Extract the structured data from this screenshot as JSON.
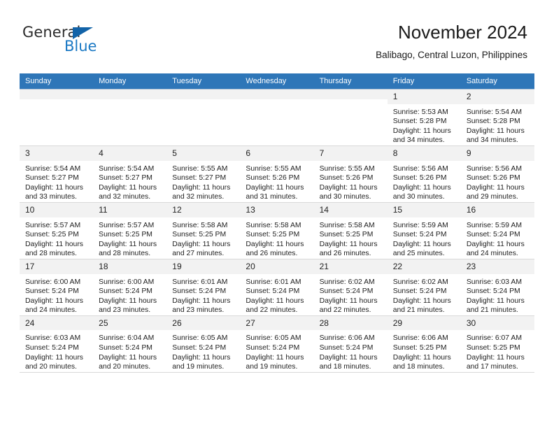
{
  "brand": {
    "name_part1": "General",
    "name_part2": "Blue",
    "accent_color": "#1b79c4",
    "triangle_color": "#1263a8",
    "triangle_icon": "triangle-icon"
  },
  "header": {
    "title": "November 2024",
    "subtitle": "Balibago, Central Luzon, Philippines"
  },
  "theme": {
    "header_row_bg": "#2e76b8",
    "daynum_bg": "#f2f2f2",
    "cell_bg": "#ffffff",
    "text_color": "#222222"
  },
  "calendar": {
    "weekday_headers": [
      "Sunday",
      "Monday",
      "Tuesday",
      "Wednesday",
      "Thursday",
      "Friday",
      "Saturday"
    ],
    "weeks": [
      [
        {
          "day": "",
          "empty": true,
          "sunrise": "",
          "sunset": "",
          "daylight_line1": "",
          "daylight_line2": ""
        },
        {
          "day": "",
          "empty": true,
          "sunrise": "",
          "sunset": "",
          "daylight_line1": "",
          "daylight_line2": ""
        },
        {
          "day": "",
          "empty": true,
          "sunrise": "",
          "sunset": "",
          "daylight_line1": "",
          "daylight_line2": ""
        },
        {
          "day": "",
          "empty": true,
          "sunrise": "",
          "sunset": "",
          "daylight_line1": "",
          "daylight_line2": ""
        },
        {
          "day": "",
          "empty": true,
          "sunrise": "",
          "sunset": "",
          "daylight_line1": "",
          "daylight_line2": ""
        },
        {
          "day": "1",
          "empty": false,
          "sunrise": "Sunrise: 5:53 AM",
          "sunset": "Sunset: 5:28 PM",
          "daylight_line1": "Daylight: 11 hours",
          "daylight_line2": "and 34 minutes."
        },
        {
          "day": "2",
          "empty": false,
          "sunrise": "Sunrise: 5:54 AM",
          "sunset": "Sunset: 5:28 PM",
          "daylight_line1": "Daylight: 11 hours",
          "daylight_line2": "and 34 minutes."
        }
      ],
      [
        {
          "day": "3",
          "empty": false,
          "sunrise": "Sunrise: 5:54 AM",
          "sunset": "Sunset: 5:27 PM",
          "daylight_line1": "Daylight: 11 hours",
          "daylight_line2": "and 33 minutes."
        },
        {
          "day": "4",
          "empty": false,
          "sunrise": "Sunrise: 5:54 AM",
          "sunset": "Sunset: 5:27 PM",
          "daylight_line1": "Daylight: 11 hours",
          "daylight_line2": "and 32 minutes."
        },
        {
          "day": "5",
          "empty": false,
          "sunrise": "Sunrise: 5:55 AM",
          "sunset": "Sunset: 5:27 PM",
          "daylight_line1": "Daylight: 11 hours",
          "daylight_line2": "and 32 minutes."
        },
        {
          "day": "6",
          "empty": false,
          "sunrise": "Sunrise: 5:55 AM",
          "sunset": "Sunset: 5:26 PM",
          "daylight_line1": "Daylight: 11 hours",
          "daylight_line2": "and 31 minutes."
        },
        {
          "day": "7",
          "empty": false,
          "sunrise": "Sunrise: 5:55 AM",
          "sunset": "Sunset: 5:26 PM",
          "daylight_line1": "Daylight: 11 hours",
          "daylight_line2": "and 30 minutes."
        },
        {
          "day": "8",
          "empty": false,
          "sunrise": "Sunrise: 5:56 AM",
          "sunset": "Sunset: 5:26 PM",
          "daylight_line1": "Daylight: 11 hours",
          "daylight_line2": "and 30 minutes."
        },
        {
          "day": "9",
          "empty": false,
          "sunrise": "Sunrise: 5:56 AM",
          "sunset": "Sunset: 5:26 PM",
          "daylight_line1": "Daylight: 11 hours",
          "daylight_line2": "and 29 minutes."
        }
      ],
      [
        {
          "day": "10",
          "empty": false,
          "sunrise": "Sunrise: 5:57 AM",
          "sunset": "Sunset: 5:25 PM",
          "daylight_line1": "Daylight: 11 hours",
          "daylight_line2": "and 28 minutes."
        },
        {
          "day": "11",
          "empty": false,
          "sunrise": "Sunrise: 5:57 AM",
          "sunset": "Sunset: 5:25 PM",
          "daylight_line1": "Daylight: 11 hours",
          "daylight_line2": "and 28 minutes."
        },
        {
          "day": "12",
          "empty": false,
          "sunrise": "Sunrise: 5:58 AM",
          "sunset": "Sunset: 5:25 PM",
          "daylight_line1": "Daylight: 11 hours",
          "daylight_line2": "and 27 minutes."
        },
        {
          "day": "13",
          "empty": false,
          "sunrise": "Sunrise: 5:58 AM",
          "sunset": "Sunset: 5:25 PM",
          "daylight_line1": "Daylight: 11 hours",
          "daylight_line2": "and 26 minutes."
        },
        {
          "day": "14",
          "empty": false,
          "sunrise": "Sunrise: 5:58 AM",
          "sunset": "Sunset: 5:25 PM",
          "daylight_line1": "Daylight: 11 hours",
          "daylight_line2": "and 26 minutes."
        },
        {
          "day": "15",
          "empty": false,
          "sunrise": "Sunrise: 5:59 AM",
          "sunset": "Sunset: 5:24 PM",
          "daylight_line1": "Daylight: 11 hours",
          "daylight_line2": "and 25 minutes."
        },
        {
          "day": "16",
          "empty": false,
          "sunrise": "Sunrise: 5:59 AM",
          "sunset": "Sunset: 5:24 PM",
          "daylight_line1": "Daylight: 11 hours",
          "daylight_line2": "and 24 minutes."
        }
      ],
      [
        {
          "day": "17",
          "empty": false,
          "sunrise": "Sunrise: 6:00 AM",
          "sunset": "Sunset: 5:24 PM",
          "daylight_line1": "Daylight: 11 hours",
          "daylight_line2": "and 24 minutes."
        },
        {
          "day": "18",
          "empty": false,
          "sunrise": "Sunrise: 6:00 AM",
          "sunset": "Sunset: 5:24 PM",
          "daylight_line1": "Daylight: 11 hours",
          "daylight_line2": "and 23 minutes."
        },
        {
          "day": "19",
          "empty": false,
          "sunrise": "Sunrise: 6:01 AM",
          "sunset": "Sunset: 5:24 PM",
          "daylight_line1": "Daylight: 11 hours",
          "daylight_line2": "and 23 minutes."
        },
        {
          "day": "20",
          "empty": false,
          "sunrise": "Sunrise: 6:01 AM",
          "sunset": "Sunset: 5:24 PM",
          "daylight_line1": "Daylight: 11 hours",
          "daylight_line2": "and 22 minutes."
        },
        {
          "day": "21",
          "empty": false,
          "sunrise": "Sunrise: 6:02 AM",
          "sunset": "Sunset: 5:24 PM",
          "daylight_line1": "Daylight: 11 hours",
          "daylight_line2": "and 22 minutes."
        },
        {
          "day": "22",
          "empty": false,
          "sunrise": "Sunrise: 6:02 AM",
          "sunset": "Sunset: 5:24 PM",
          "daylight_line1": "Daylight: 11 hours",
          "daylight_line2": "and 21 minutes."
        },
        {
          "day": "23",
          "empty": false,
          "sunrise": "Sunrise: 6:03 AM",
          "sunset": "Sunset: 5:24 PM",
          "daylight_line1": "Daylight: 11 hours",
          "daylight_line2": "and 21 minutes."
        }
      ],
      [
        {
          "day": "24",
          "empty": false,
          "sunrise": "Sunrise: 6:03 AM",
          "sunset": "Sunset: 5:24 PM",
          "daylight_line1": "Daylight: 11 hours",
          "daylight_line2": "and 20 minutes."
        },
        {
          "day": "25",
          "empty": false,
          "sunrise": "Sunrise: 6:04 AM",
          "sunset": "Sunset: 5:24 PM",
          "daylight_line1": "Daylight: 11 hours",
          "daylight_line2": "and 20 minutes."
        },
        {
          "day": "26",
          "empty": false,
          "sunrise": "Sunrise: 6:05 AM",
          "sunset": "Sunset: 5:24 PM",
          "daylight_line1": "Daylight: 11 hours",
          "daylight_line2": "and 19 minutes."
        },
        {
          "day": "27",
          "empty": false,
          "sunrise": "Sunrise: 6:05 AM",
          "sunset": "Sunset: 5:24 PM",
          "daylight_line1": "Daylight: 11 hours",
          "daylight_line2": "and 19 minutes."
        },
        {
          "day": "28",
          "empty": false,
          "sunrise": "Sunrise: 6:06 AM",
          "sunset": "Sunset: 5:24 PM",
          "daylight_line1": "Daylight: 11 hours",
          "daylight_line2": "and 18 minutes."
        },
        {
          "day": "29",
          "empty": false,
          "sunrise": "Sunrise: 6:06 AM",
          "sunset": "Sunset: 5:25 PM",
          "daylight_line1": "Daylight: 11 hours",
          "daylight_line2": "and 18 minutes."
        },
        {
          "day": "30",
          "empty": false,
          "sunrise": "Sunrise: 6:07 AM",
          "sunset": "Sunset: 5:25 PM",
          "daylight_line1": "Daylight: 11 hours",
          "daylight_line2": "and 17 minutes."
        }
      ]
    ]
  }
}
